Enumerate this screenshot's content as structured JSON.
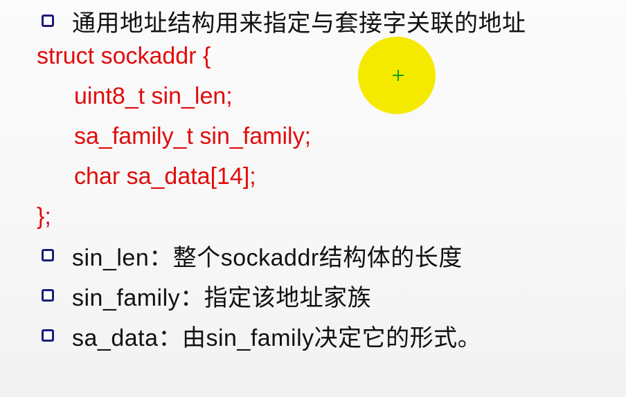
{
  "slide": {
    "heading": "通用地址结构用来指定与套接字关联的地址",
    "code": {
      "open": "struct sockaddr {",
      "fields": [
        "uint8_t  sin_len;",
        "sa_family_t  sin_family;",
        "char sa_data[14];"
      ],
      "close": "};"
    },
    "notes": [
      "sin_len：整个sockaddr结构体的长度",
      "sin_family：指定该地址家族",
      "sa_data：由sin_family决定它的形式。"
    ]
  },
  "colors": {
    "code_text": "#e10b0b",
    "body_text": "#111111",
    "bullet_border": "#1b1b7a",
    "pointer_fill": "#f4ea00",
    "pointer_cross": "#12a212"
  },
  "icons": {
    "bullet": "hollow-square-bullet-icon",
    "pointer": "presentation-pointer-highlight-icon"
  }
}
